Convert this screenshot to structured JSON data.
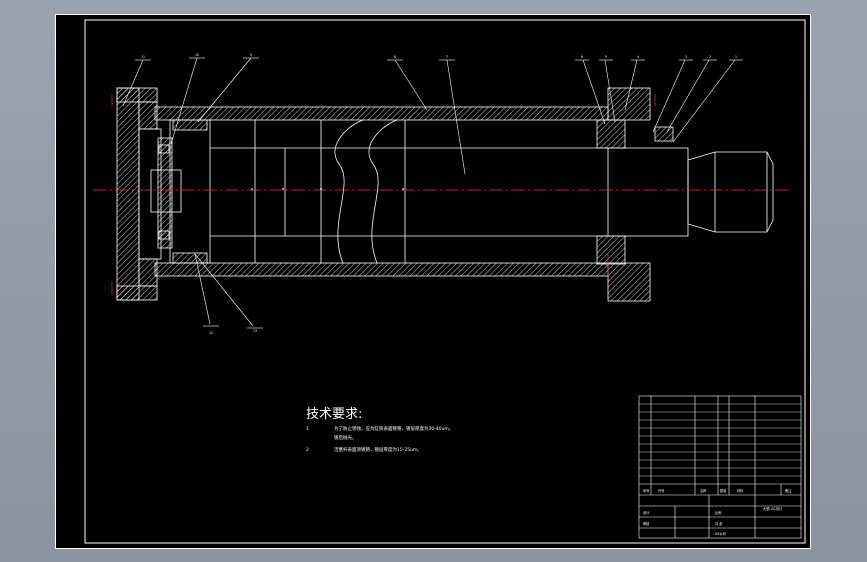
{
  "colors": {
    "background": "#000000",
    "line": "#ffffff",
    "hatch": "#ffffff",
    "centerline": "#ff2a2a",
    "dimension": "#ffffff"
  },
  "balloons": [
    "11",
    "10",
    "9",
    "8",
    "7",
    "6",
    "5",
    "4",
    "3",
    "2",
    "1",
    "12",
    "13"
  ],
  "section_marks": [
    "φ",
    "φ",
    "φ",
    "φ"
  ],
  "tech_requirements": {
    "title": "技术要求:",
    "items": [
      {
        "num": "1",
        "line1": "为了防止锈蚀，应为缸筒表面镀铬，镀层厚度为30-40um。",
        "line2": "镀后抛光。"
      },
      {
        "num": "2",
        "line1": "活塞杆表面须镀铬，镀层厚度为15-25um。",
        "line2": ""
      }
    ]
  },
  "title_block": {
    "header": [
      "序号",
      "代号",
      "名称",
      "数量",
      "材料",
      "备注"
    ],
    "title": "大型LGC设计",
    "designer_label": "设计",
    "checker_label": "审核",
    "scale_label": "比例",
    "sheet_label": "共 张",
    "company_label": "XX公司"
  }
}
